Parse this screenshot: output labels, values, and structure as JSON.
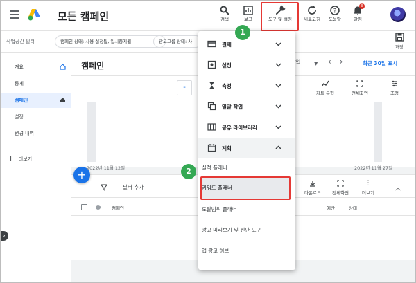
{
  "app": {
    "title": "모든 캠페인"
  },
  "topbar": {
    "search_label": "검색",
    "report_label": "보고",
    "tools_label": "도구 및 설정",
    "refresh_label": "새로고침",
    "help_label": "도움말",
    "alerts_label": "알림",
    "alerts_badge": "!"
  },
  "filterbar": {
    "workspace_filter": "작업공간 필터",
    "chip1": "캠페인 상태: 사용 설정됨, 일시중지됨",
    "chip2": "광고그룹 상태: 사",
    "save_label": "저장"
  },
  "sidebar": {
    "items": [
      {
        "label": "개요"
      },
      {
        "label": "통계"
      },
      {
        "label": "캠페인"
      },
      {
        "label": "설정"
      },
      {
        "label": "변경 내역"
      }
    ],
    "more_label": "더보기"
  },
  "main": {
    "page_title": "캠페인",
    "date_select": "3일",
    "recent_link": "최근 30일 표시",
    "chart_type_label": "차트 유형",
    "fullscreen_label": "전체화면",
    "adjust_label": "조정",
    "metric_chip": "-",
    "date_start": "2022년 11월 12일",
    "date_end": "2022년 11월 27일",
    "add_filter": "필터 추가",
    "download_label": "다운로드",
    "fullscreen2_label": "전체화면",
    "more_label": "더보기",
    "columns": {
      "campaign": "캠페인",
      "budget": "예산",
      "status": "상태"
    }
  },
  "menu": {
    "sections": [
      {
        "label": "결제",
        "icon": "credit-card-icon"
      },
      {
        "label": "설정",
        "icon": "settings-box-icon"
      },
      {
        "label": "측정",
        "icon": "hourglass-icon"
      },
      {
        "label": "일괄 작업",
        "icon": "copy-icon"
      },
      {
        "label": "공유 라이브러리",
        "icon": "grid-icon"
      },
      {
        "label": "계획",
        "icon": "calendar-icon"
      }
    ],
    "planning_items": [
      {
        "label": "실적 플래너"
      },
      {
        "label": "키워드 플래너"
      },
      {
        "label": "도달범위 플래너"
      },
      {
        "label": "광고 미리보기 및 진단 도구"
      },
      {
        "label": "앱 광고 허브"
      }
    ]
  },
  "steps": {
    "one": "1",
    "two": "2"
  },
  "colors": {
    "accent": "#1a73e8",
    "highlight": "#e53935",
    "step": "#34a853"
  }
}
